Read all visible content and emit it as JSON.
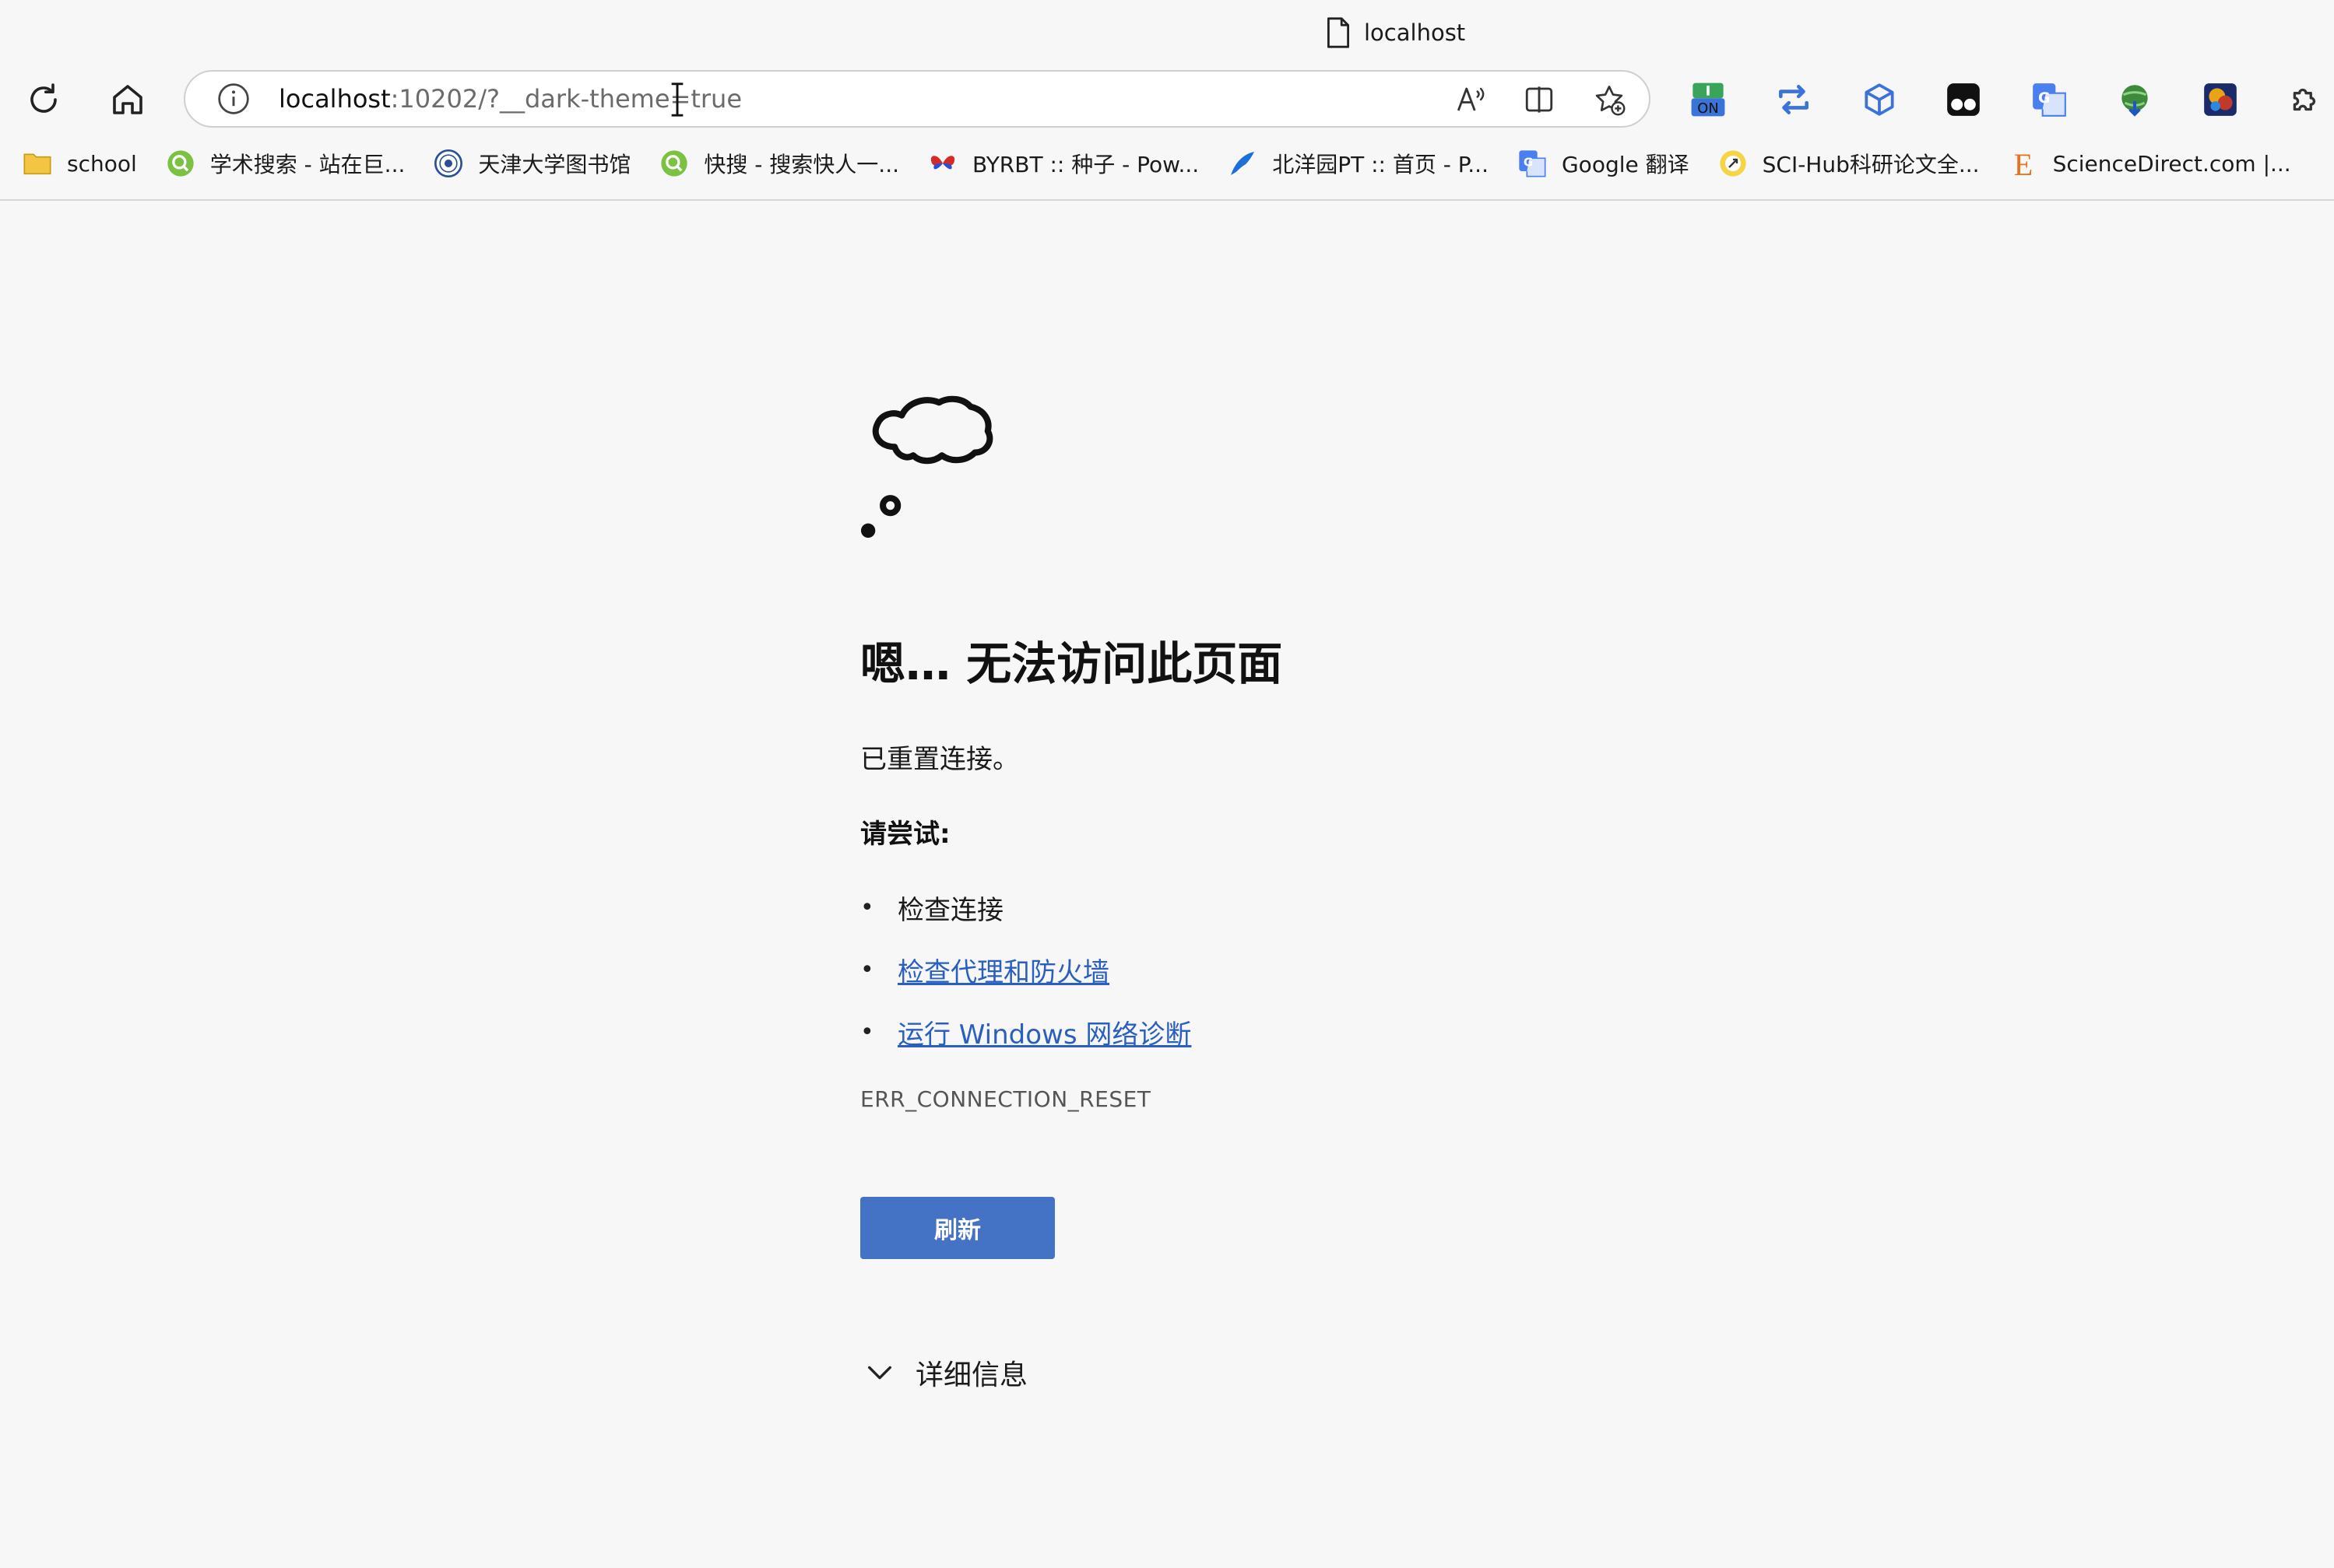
{
  "browser": {
    "tab_title": "localhost",
    "address": {
      "host": "localhost",
      "rest": ":10202/?__dark-theme=true"
    },
    "ext_badge": "ON",
    "bookmarks": [
      {
        "label": "school"
      },
      {
        "label": "学术搜索 - 站在巨..."
      },
      {
        "label": "天津大学图书馆"
      },
      {
        "label": "快搜 - 搜索快人一..."
      },
      {
        "label": "BYRBT :: 种子 - Pow..."
      },
      {
        "label": "北洋园PT :: 首页 - P..."
      },
      {
        "label": "Google 翻译"
      },
      {
        "label": "SCI-Hub科研论文全..."
      },
      {
        "label": "ScienceDirect.com |..."
      }
    ]
  },
  "page": {
    "headline": "嗯… 无法访问此页面",
    "message": "已重置连接。",
    "try_label": "请尝试:",
    "suggestions": [
      {
        "text": "检查连接"
      },
      {
        "text": "检查代理和防火墙"
      },
      {
        "text": "运行 Windows 网络诊断"
      }
    ],
    "error_code": "ERR_CONNECTION_RESET",
    "refresh_label": "刷新",
    "details_label": "详细信息"
  },
  "colors": {
    "background": "#f7f7f7",
    "link": "#2a5fbf",
    "button": "#4472c4"
  }
}
